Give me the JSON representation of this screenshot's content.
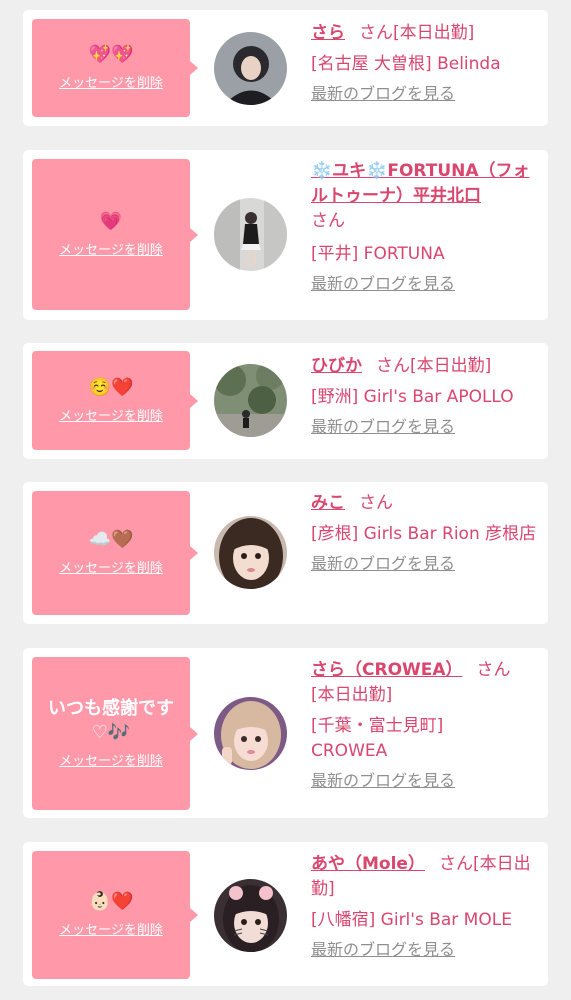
{
  "delete_label": "メッセージを削除",
  "blog_label": "最新のブログを見る",
  "san_label": "さん",
  "colors": {
    "accent_pink": "#ff98a9",
    "name_pink": "#d9466e",
    "link_gray": "#8f8f8f",
    "background": "#efefef"
  },
  "cards": [
    {
      "message": "💖💖",
      "name": "さら",
      "status": "[本日出勤]",
      "shop": "[名古屋 大曽根] Belinda"
    },
    {
      "message": "💗",
      "name": "❄️ユキ❄️FORTUNA（フォルトゥーナ）平井北口",
      "status": "",
      "shop": "[平井] FORTUNA"
    },
    {
      "message": "☺️❤️",
      "name": "ひびか",
      "status": "[本日出勤]",
      "shop": "[野洲] Girl's Bar APOLLO"
    },
    {
      "message": "☁️🤎",
      "name": "みこ",
      "status": "",
      "shop": "[彦根] Girls Bar Rion 彦根店"
    },
    {
      "message": "いつも感謝です♡🎶",
      "name": "さら（CROWEA）",
      "status": "[本日出勤]",
      "shop": "[千葉・富士見町] CROWEA"
    },
    {
      "message": "👶🏻❤️",
      "name": "あや（Mole）",
      "status": "[本日出勤]",
      "shop": "[八幡宿] Girl's Bar MOLE"
    }
  ]
}
